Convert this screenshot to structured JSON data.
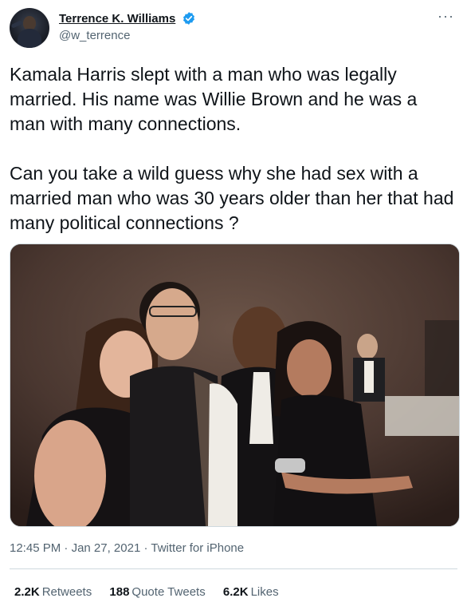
{
  "author": {
    "display_name": "Terrence K. Williams",
    "handle": "@w_terrence",
    "verified": true,
    "avatar_icon": "profile-avatar"
  },
  "more_icon": "ellipsis-icon",
  "tweet": {
    "text": "Kamala Harris slept with a man who was legally married. His name was Willie Brown and he was a man with many connections.\n\nCan you take a wild guess why she had sex with a married man who was 30 years older than her that had many political connections ?",
    "photo": "embedded-photo"
  },
  "meta": {
    "time": "12:45 PM",
    "separator": "·",
    "date": "Jan 27, 2021",
    "source": "Twitter for iPhone"
  },
  "stats": {
    "retweets_count": "2.2K",
    "retweets_label": "Retweets",
    "quotes_count": "188",
    "quotes_label": "Quote Tweets",
    "likes_count": "6.2K",
    "likes_label": "Likes"
  },
  "colors": {
    "text": "#0f1419",
    "secondary": "#536471",
    "verified_blue": "#1d9bf0",
    "border": "#cfd9de"
  }
}
